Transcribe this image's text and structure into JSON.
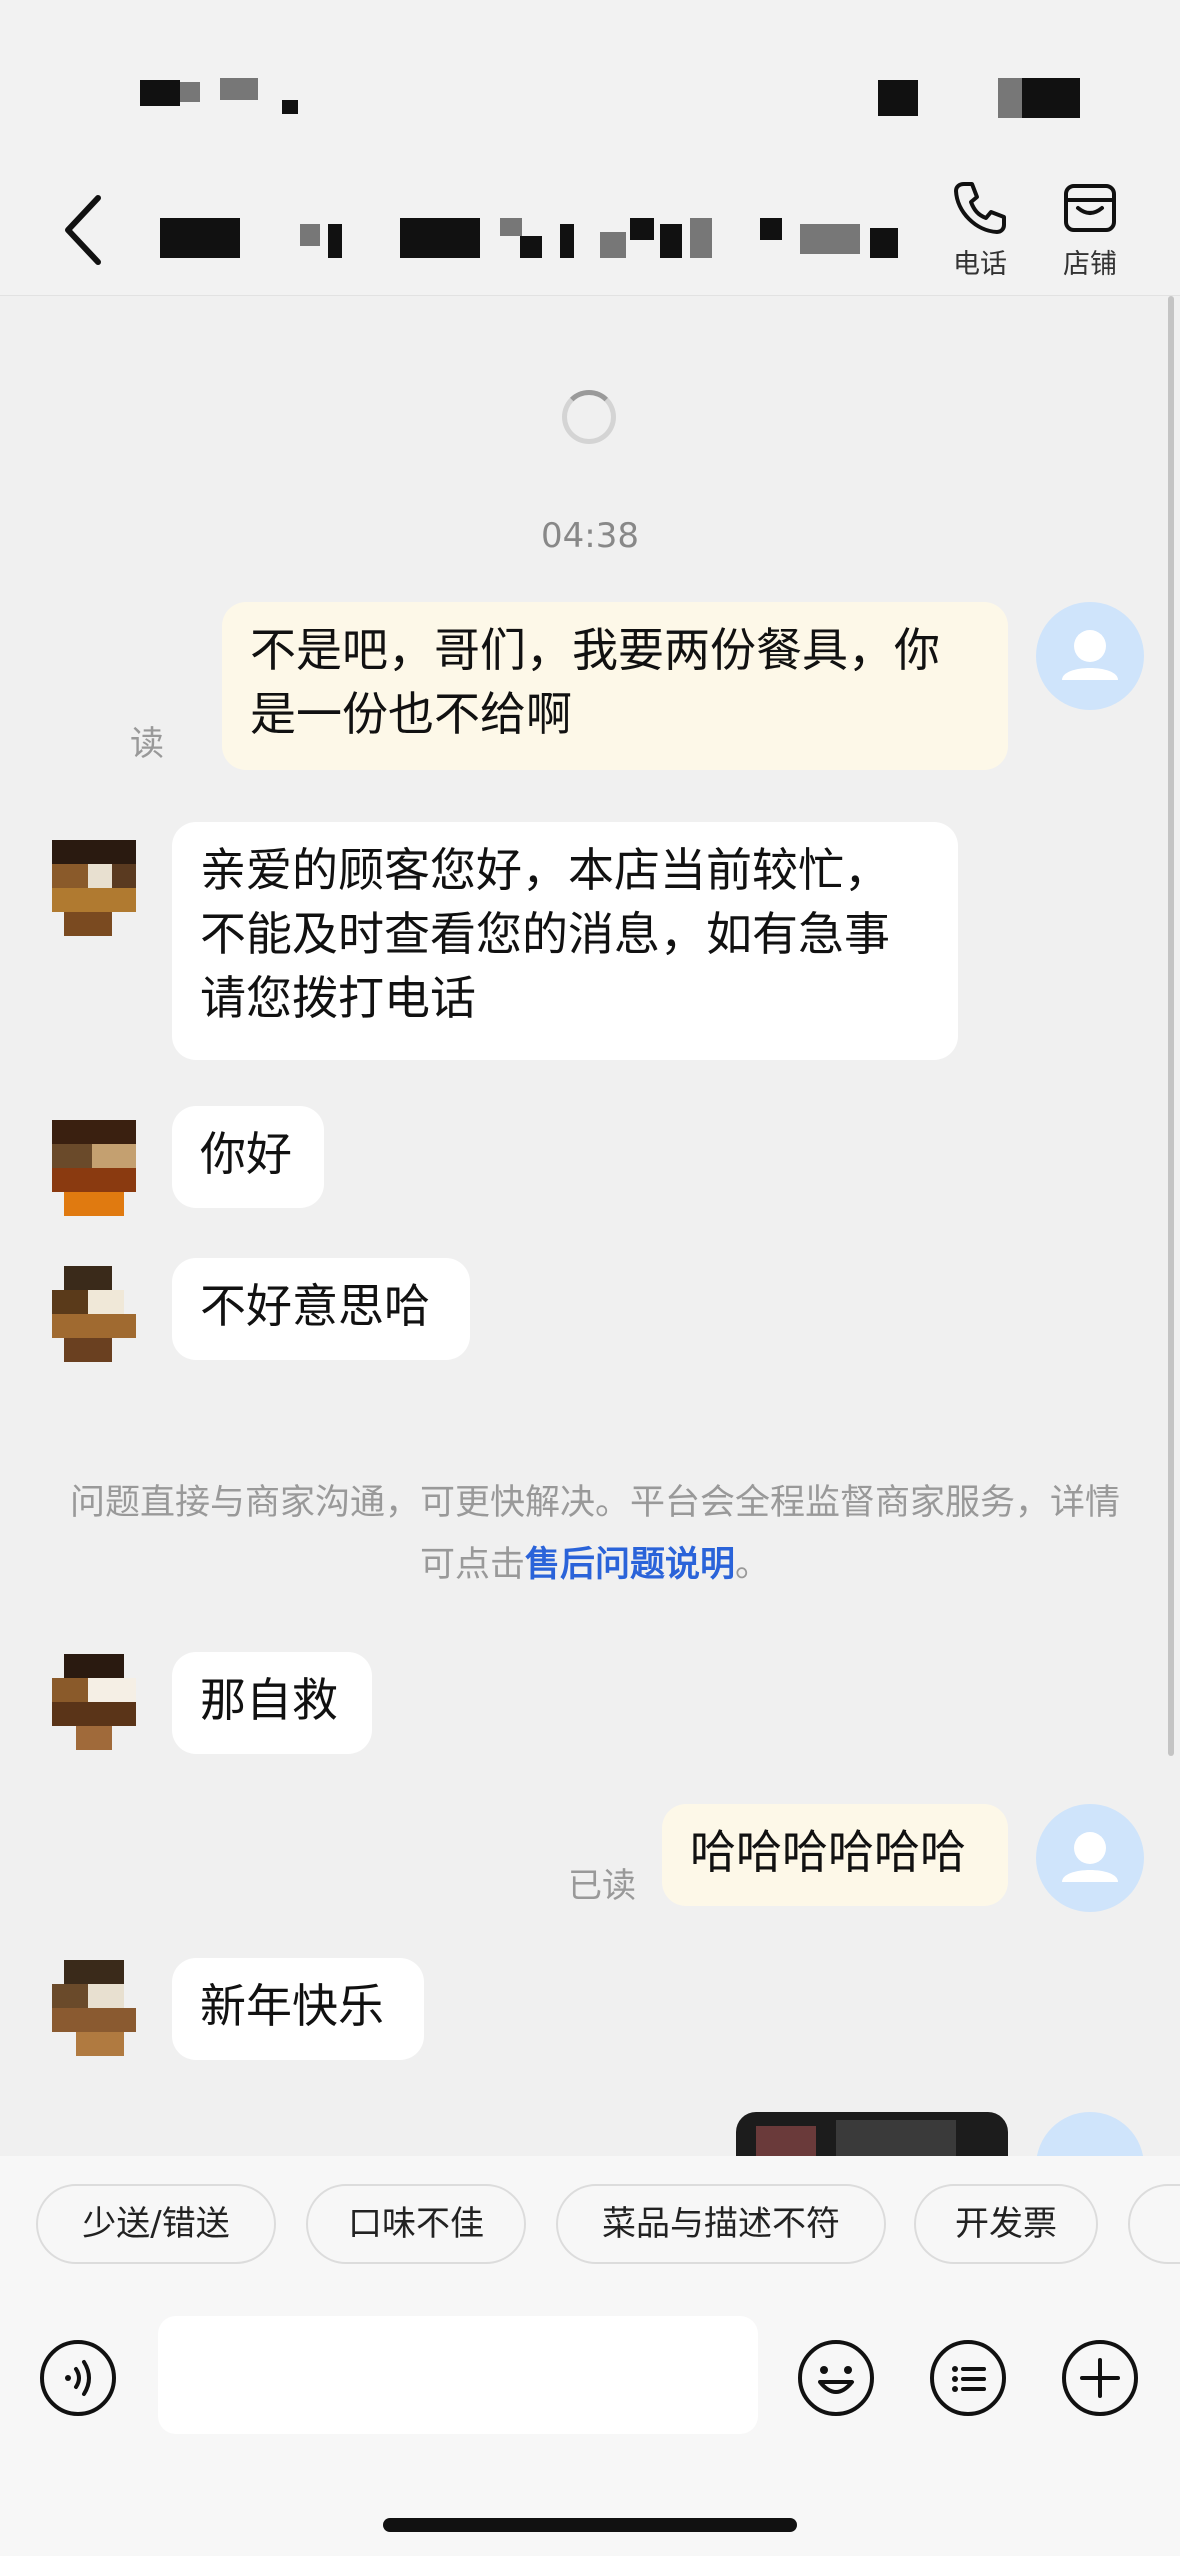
{
  "nav": {
    "phone_label": "电话",
    "store_label": "店铺"
  },
  "chat": {
    "timestamp": "04:38",
    "messages": [
      {
        "from": "self",
        "text": "不是吧，哥们，我要两份餐具，你是一份也不给啊",
        "read": "读"
      },
      {
        "from": "merchant",
        "text": "亲爱的顾客您好，本店当前较忙，不能及时查看您的消息，如有急事请您拨打电话"
      },
      {
        "from": "merchant",
        "text": "你好"
      },
      {
        "from": "merchant",
        "text": "不好意思哈"
      },
      {
        "from": "merchant",
        "text": "那自救"
      },
      {
        "from": "self",
        "text": "哈哈哈哈哈哈",
        "read": "已读"
      },
      {
        "from": "merchant",
        "text": "新年快乐"
      }
    ],
    "system_notice": {
      "text_before": "问题直接与商家沟通，可更快解决。平台会全程监督商家服务，详情可点击",
      "link": "售后问题说明",
      "text_after": "。"
    }
  },
  "quick_replies": [
    "少送/错送",
    "口味不佳",
    "菜品与描述不符",
    "开发票"
  ],
  "input": {
    "placeholder": ""
  },
  "colors": {
    "self_bubble": "#fdf8e8",
    "other_bubble": "#ffffff",
    "link": "#2a63d9",
    "avatar_bg": "#cfe4fb"
  }
}
